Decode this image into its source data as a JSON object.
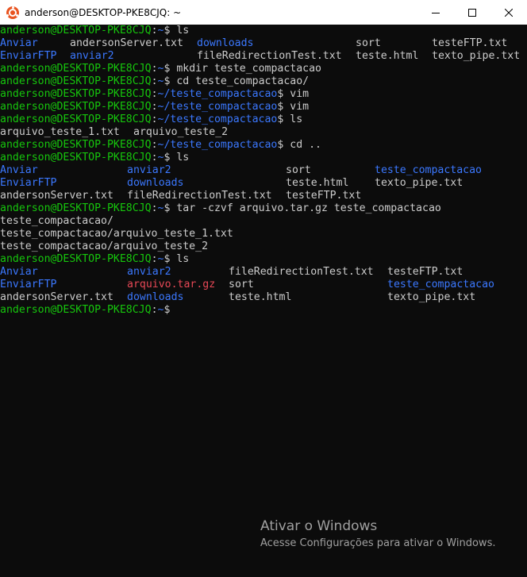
{
  "window": {
    "title": "anderson@DESKTOP-PKE8CJQ: ~",
    "icon": "ubuntu-icon"
  },
  "colors": {
    "background": "#0c0c0c",
    "text": "#cccccc",
    "user": "#16c60c",
    "directory": "#3b78ff",
    "archive": "#e74856"
  },
  "terminal": {
    "user_host": "anderson@DESKTOP-PKE8CJQ",
    "lines": [
      {
        "type": "prompt",
        "path": "~",
        "cmd": "ls"
      },
      {
        "type": "cols",
        "cells": [
          {
            "text": "Anviar",
            "cls": "dir",
            "col": 0
          },
          {
            "text": "andersonServer.txt",
            "cls": "",
            "col": 11
          },
          {
            "text": "downloads",
            "cls": "dir",
            "col": 31
          },
          {
            "text": "sort",
            "cls": "",
            "col": 56
          },
          {
            "text": "testeFTP.txt",
            "cls": "",
            "col": 68
          }
        ]
      },
      {
        "type": "cols",
        "cells": [
          {
            "text": "EnviarFTP",
            "cls": "dir",
            "col": 0
          },
          {
            "text": "anviar2",
            "cls": "dir",
            "col": 11
          },
          {
            "text": "fileRedirectionTest.txt",
            "cls": "",
            "col": 31
          },
          {
            "text": "teste.html",
            "cls": "",
            "col": 56
          },
          {
            "text": "texto_pipe.txt",
            "cls": "",
            "col": 68
          }
        ]
      },
      {
        "type": "prompt",
        "path": "~",
        "cmd": "mkdir teste_compactacao"
      },
      {
        "type": "prompt",
        "path": "~",
        "cmd": "cd teste_compactacao/"
      },
      {
        "type": "prompt",
        "path": "~/teste_compactacao",
        "cmd": "vim"
      },
      {
        "type": "prompt",
        "path": "~/teste_compactacao",
        "cmd": "vim"
      },
      {
        "type": "prompt",
        "path": "~/teste_compactacao",
        "cmd": "ls"
      },
      {
        "type": "cols",
        "cells": [
          {
            "text": "arquivo_teste_1.txt",
            "cls": "",
            "col": 0
          },
          {
            "text": "arquivo_teste_2",
            "cls": "",
            "col": 21
          }
        ]
      },
      {
        "type": "prompt",
        "path": "~/teste_compactacao",
        "cmd": "cd .."
      },
      {
        "type": "prompt",
        "path": "~",
        "cmd": "ls"
      },
      {
        "type": "cols",
        "cells": [
          {
            "text": "Anviar",
            "cls": "dir",
            "col": 0
          },
          {
            "text": "anviar2",
            "cls": "dir",
            "col": 20
          },
          {
            "text": "sort",
            "cls": "",
            "col": 45
          },
          {
            "text": "teste_compactacao",
            "cls": "dir",
            "col": 59
          }
        ]
      },
      {
        "type": "cols",
        "cells": [
          {
            "text": "EnviarFTP",
            "cls": "dir",
            "col": 0
          },
          {
            "text": "downloads",
            "cls": "dir",
            "col": 20
          },
          {
            "text": "teste.html",
            "cls": "",
            "col": 45
          },
          {
            "text": "texto_pipe.txt",
            "cls": "",
            "col": 59
          }
        ]
      },
      {
        "type": "cols",
        "cells": [
          {
            "text": "andersonServer.txt",
            "cls": "",
            "col": 0
          },
          {
            "text": "fileRedirectionTest.txt",
            "cls": "",
            "col": 20
          },
          {
            "text": "testeFTP.txt",
            "cls": "",
            "col": 45
          }
        ]
      },
      {
        "type": "prompt",
        "path": "~",
        "cmd": "tar -czvf arquivo.tar.gz teste_compactacao"
      },
      {
        "type": "cols",
        "cells": [
          {
            "text": "teste_compactacao/",
            "cls": "",
            "col": 0
          }
        ]
      },
      {
        "type": "cols",
        "cells": [
          {
            "text": "teste_compactacao/arquivo_teste_1.txt",
            "cls": "",
            "col": 0
          }
        ]
      },
      {
        "type": "cols",
        "cells": [
          {
            "text": "teste_compactacao/arquivo_teste_2",
            "cls": "",
            "col": 0
          }
        ]
      },
      {
        "type": "prompt",
        "path": "~",
        "cmd": "ls"
      },
      {
        "type": "cols",
        "cells": [
          {
            "text": "Anviar",
            "cls": "dir",
            "col": 0
          },
          {
            "text": "anviar2",
            "cls": "dir",
            "col": 20
          },
          {
            "text": "fileRedirectionTest.txt",
            "cls": "",
            "col": 36
          },
          {
            "text": "testeFTP.txt",
            "cls": "",
            "col": 61
          }
        ]
      },
      {
        "type": "cols",
        "cells": [
          {
            "text": "EnviarFTP",
            "cls": "dir",
            "col": 0
          },
          {
            "text": "arquivo.tar.gz",
            "cls": "arch",
            "col": 20
          },
          {
            "text": "sort",
            "cls": "",
            "col": 36
          },
          {
            "text": "teste_compactacao",
            "cls": "dir",
            "col": 61
          }
        ]
      },
      {
        "type": "cols",
        "cells": [
          {
            "text": "andersonServer.txt",
            "cls": "",
            "col": 0
          },
          {
            "text": "downloads",
            "cls": "dir",
            "col": 20
          },
          {
            "text": "teste.html",
            "cls": "",
            "col": 36
          },
          {
            "text": "texto_pipe.txt",
            "cls": "",
            "col": 61
          }
        ]
      },
      {
        "type": "prompt",
        "path": "~",
        "cmd": ""
      }
    ]
  },
  "watermark": {
    "title": "Ativar o Windows",
    "subtitle": "Acesse Configurações para ativar o Windows."
  }
}
